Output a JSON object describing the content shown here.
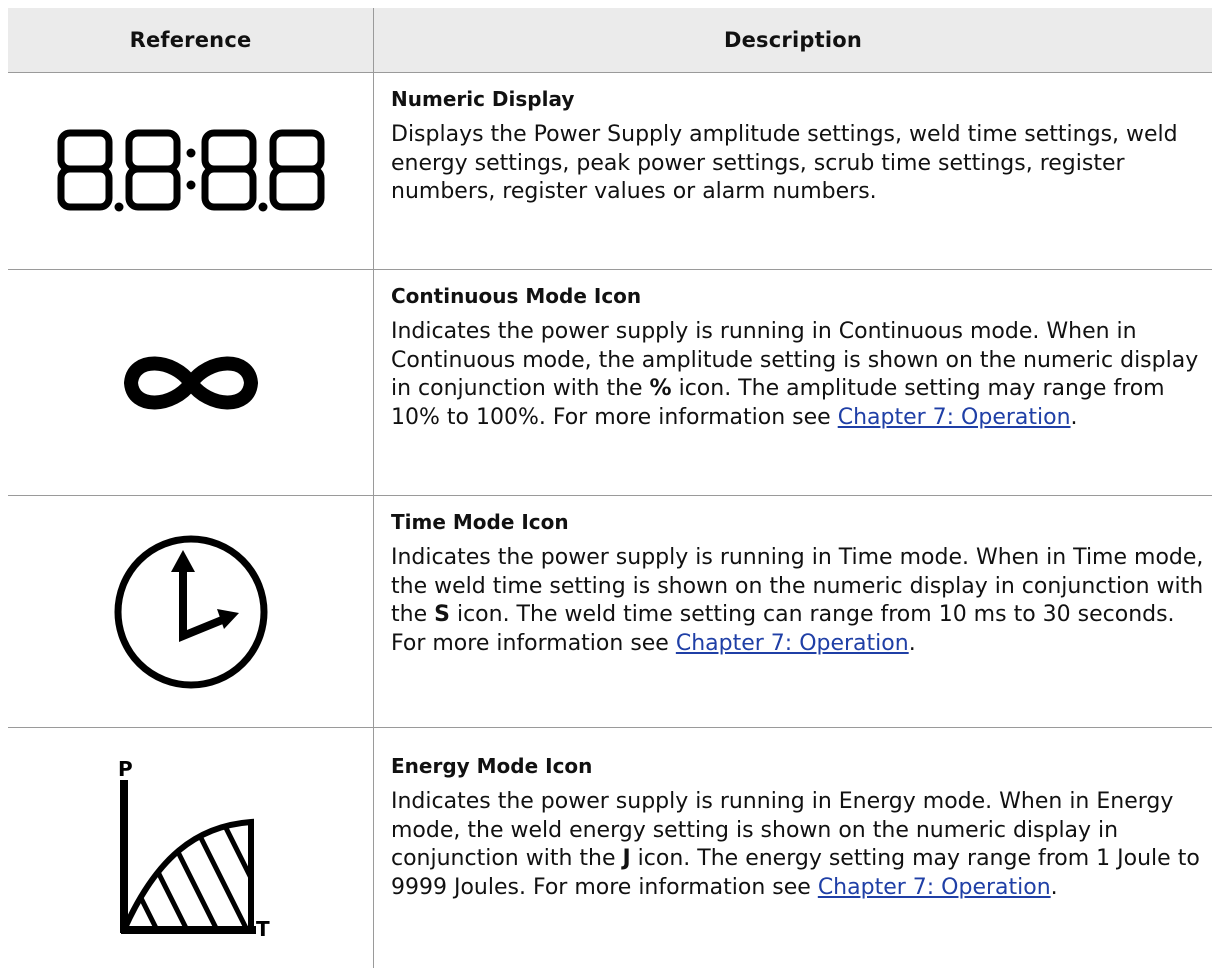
{
  "header": {
    "reference": "Reference",
    "description": "Description"
  },
  "rows": [
    {
      "icon": "seven-segment-display-icon",
      "title": "Numeric Display",
      "text": "Displays the Power Supply amplitude settings, weld time settings, weld energy settings, peak power settings, scrub time settings, register numbers, register values or alarm numbers."
    },
    {
      "icon": "infinity-icon",
      "title": "Continuous Mode Icon",
      "text_a": "Indicates the power supply is running in Continuous mode. When in Continuous mode, the amplitude setting is shown on the numeric display in conjunction with the ",
      "bold": "%",
      "text_b": " icon. The amplitude setting may range from 10% to 100%. For more information see ",
      "link": "Chapter 7: Operation",
      "end": "."
    },
    {
      "icon": "clock-icon",
      "title": "Time Mode Icon",
      "text_a": "Indicates the power supply is running in Time mode. When in Time mode, the weld time setting is shown on the numeric display in conjunction with the ",
      "bold": "S",
      "text_b": " icon. The weld time setting can range from 10 ms to 30 seconds. For more information see ",
      "link": "Chapter 7: Operation",
      "end": "."
    },
    {
      "icon": "energy-curve-icon",
      "title": "Energy Mode Icon",
      "text_a": "Indicates the power supply is running in Energy mode. When in Energy mode, the weld energy setting is shown on the numeric display in conjunction with the ",
      "bold": "J",
      "text_b": " icon. The energy setting may range from 1 Joule to 9999 Joules. For more information see ",
      "link": "Chapter 7: Operation",
      "end": ".",
      "axis_p": "P",
      "axis_t": "T"
    }
  ],
  "colors": {
    "header_bg": "#ebebeb",
    "link": "#1f3fa6",
    "border": "#9a9a9a"
  }
}
